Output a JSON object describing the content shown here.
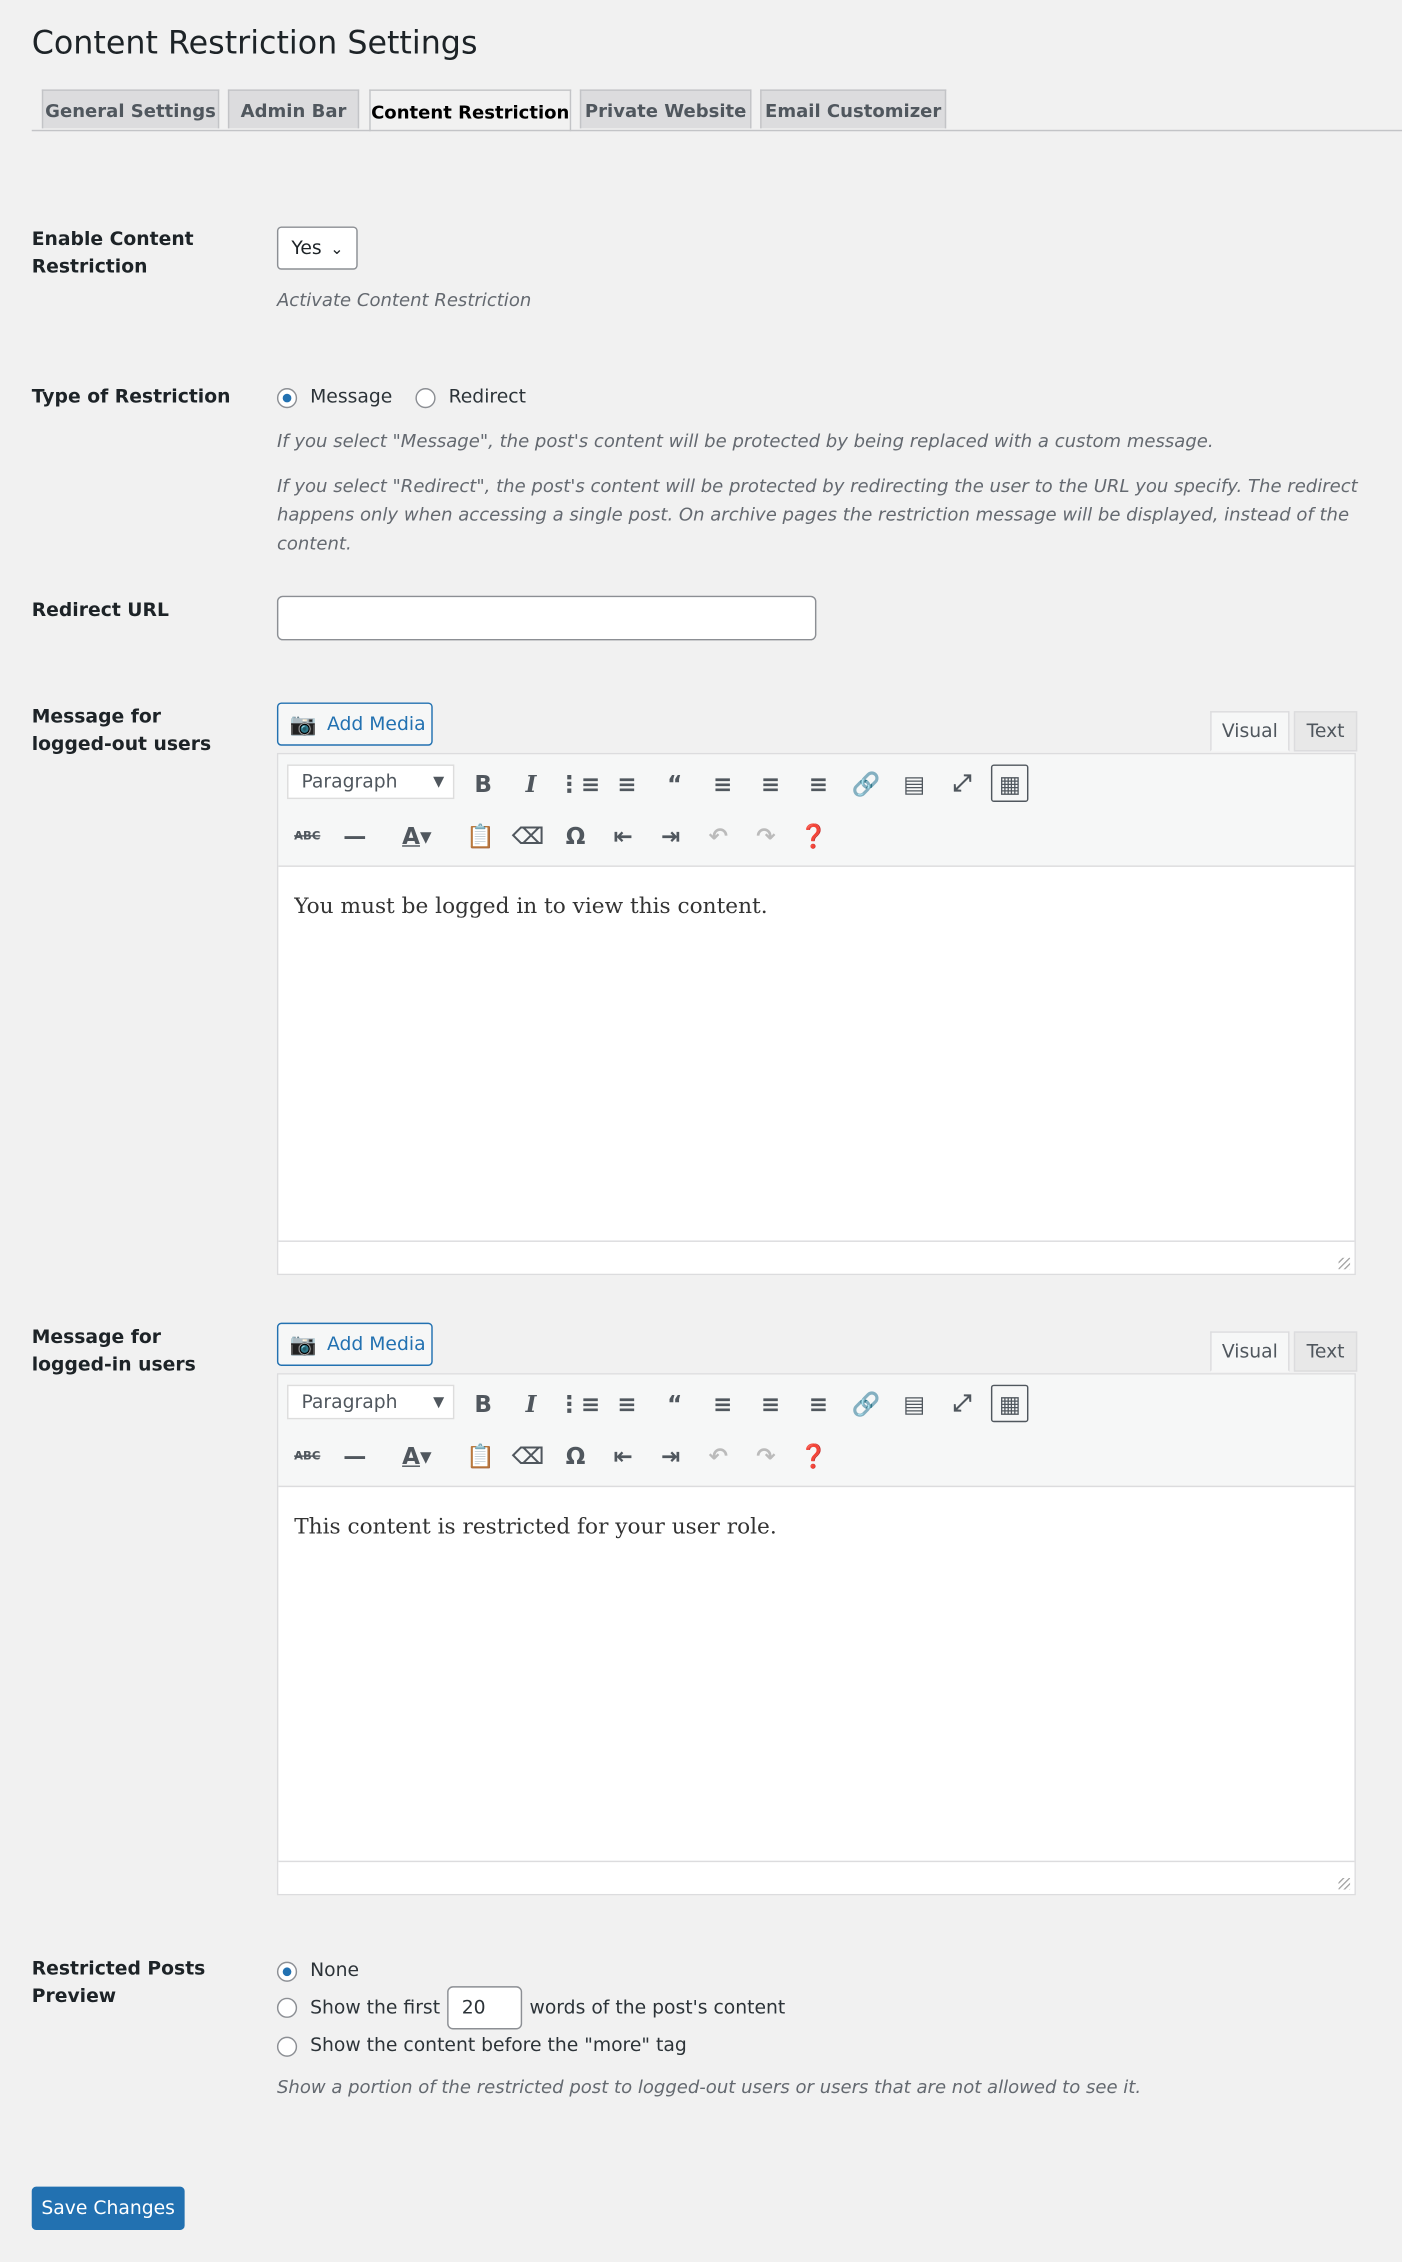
{
  "title": "Content Restriction Settings",
  "tabs": [
    {
      "label": "General Settings"
    },
    {
      "label": "Admin Bar"
    },
    {
      "label": "Content Restriction",
      "active": true
    },
    {
      "label": "Private Website"
    },
    {
      "label": "Email Customizer"
    }
  ],
  "enable": {
    "label": "Enable Content Restriction",
    "value": "Yes",
    "description": "Activate Content Restriction"
  },
  "type": {
    "label": "Type of Restriction",
    "options": [
      "Message",
      "Redirect"
    ],
    "selected": "Message",
    "desc1": "If you select \"Message\", the post's content will be protected by being replaced with a custom message.",
    "desc2": "If you select \"Redirect\", the post's content will be protected by redirecting the user to the URL you specify. The redirect happens only when accessing a single post. On archive pages the restriction message will be displayed, instead of the content."
  },
  "redirect": {
    "label": "Redirect URL",
    "value": ""
  },
  "editors": [
    {
      "label": "Message for logged-out users",
      "add_media": "Add Media",
      "visual": "Visual",
      "text": "Text",
      "format": "Paragraph",
      "content": "You must be logged in to view this content."
    },
    {
      "label": "Message for logged-in users",
      "add_media": "Add Media",
      "visual": "Visual",
      "text": "Text",
      "format": "Paragraph",
      "content": "This content is restricted for your user role."
    }
  ],
  "toolbar_row1": [
    "bold-icon",
    "italic-icon",
    "bullet-list-icon",
    "numbered-list-icon",
    "blockquote-icon",
    "align-left-icon",
    "align-center-icon",
    "align-right-icon",
    "link-icon",
    "read-more-icon",
    "fullscreen-icon",
    "toolbar-toggle-icon"
  ],
  "toolbar_row2": [
    "strikethrough-icon",
    "horizontal-line-icon",
    "text-color-icon",
    "paste-text-icon",
    "clear-formatting-icon",
    "special-character-icon",
    "outdent-icon",
    "indent-icon",
    "undo-icon",
    "redo-icon",
    "help-icon"
  ],
  "preview": {
    "label": "Restricted Posts Preview",
    "opt_none": "None",
    "opt_first_pre": "Show the first",
    "words": "20",
    "opt_first_post": "words of the post's content",
    "opt_more": "Show the content before the \"more\" tag",
    "selected": "None",
    "description": "Show a portion of the restricted post to logged-out users or users that are not allowed to see it."
  },
  "save_label": "Save Changes",
  "colors": {
    "accent": "#2271b1",
    "background": "#f1f1f1"
  }
}
